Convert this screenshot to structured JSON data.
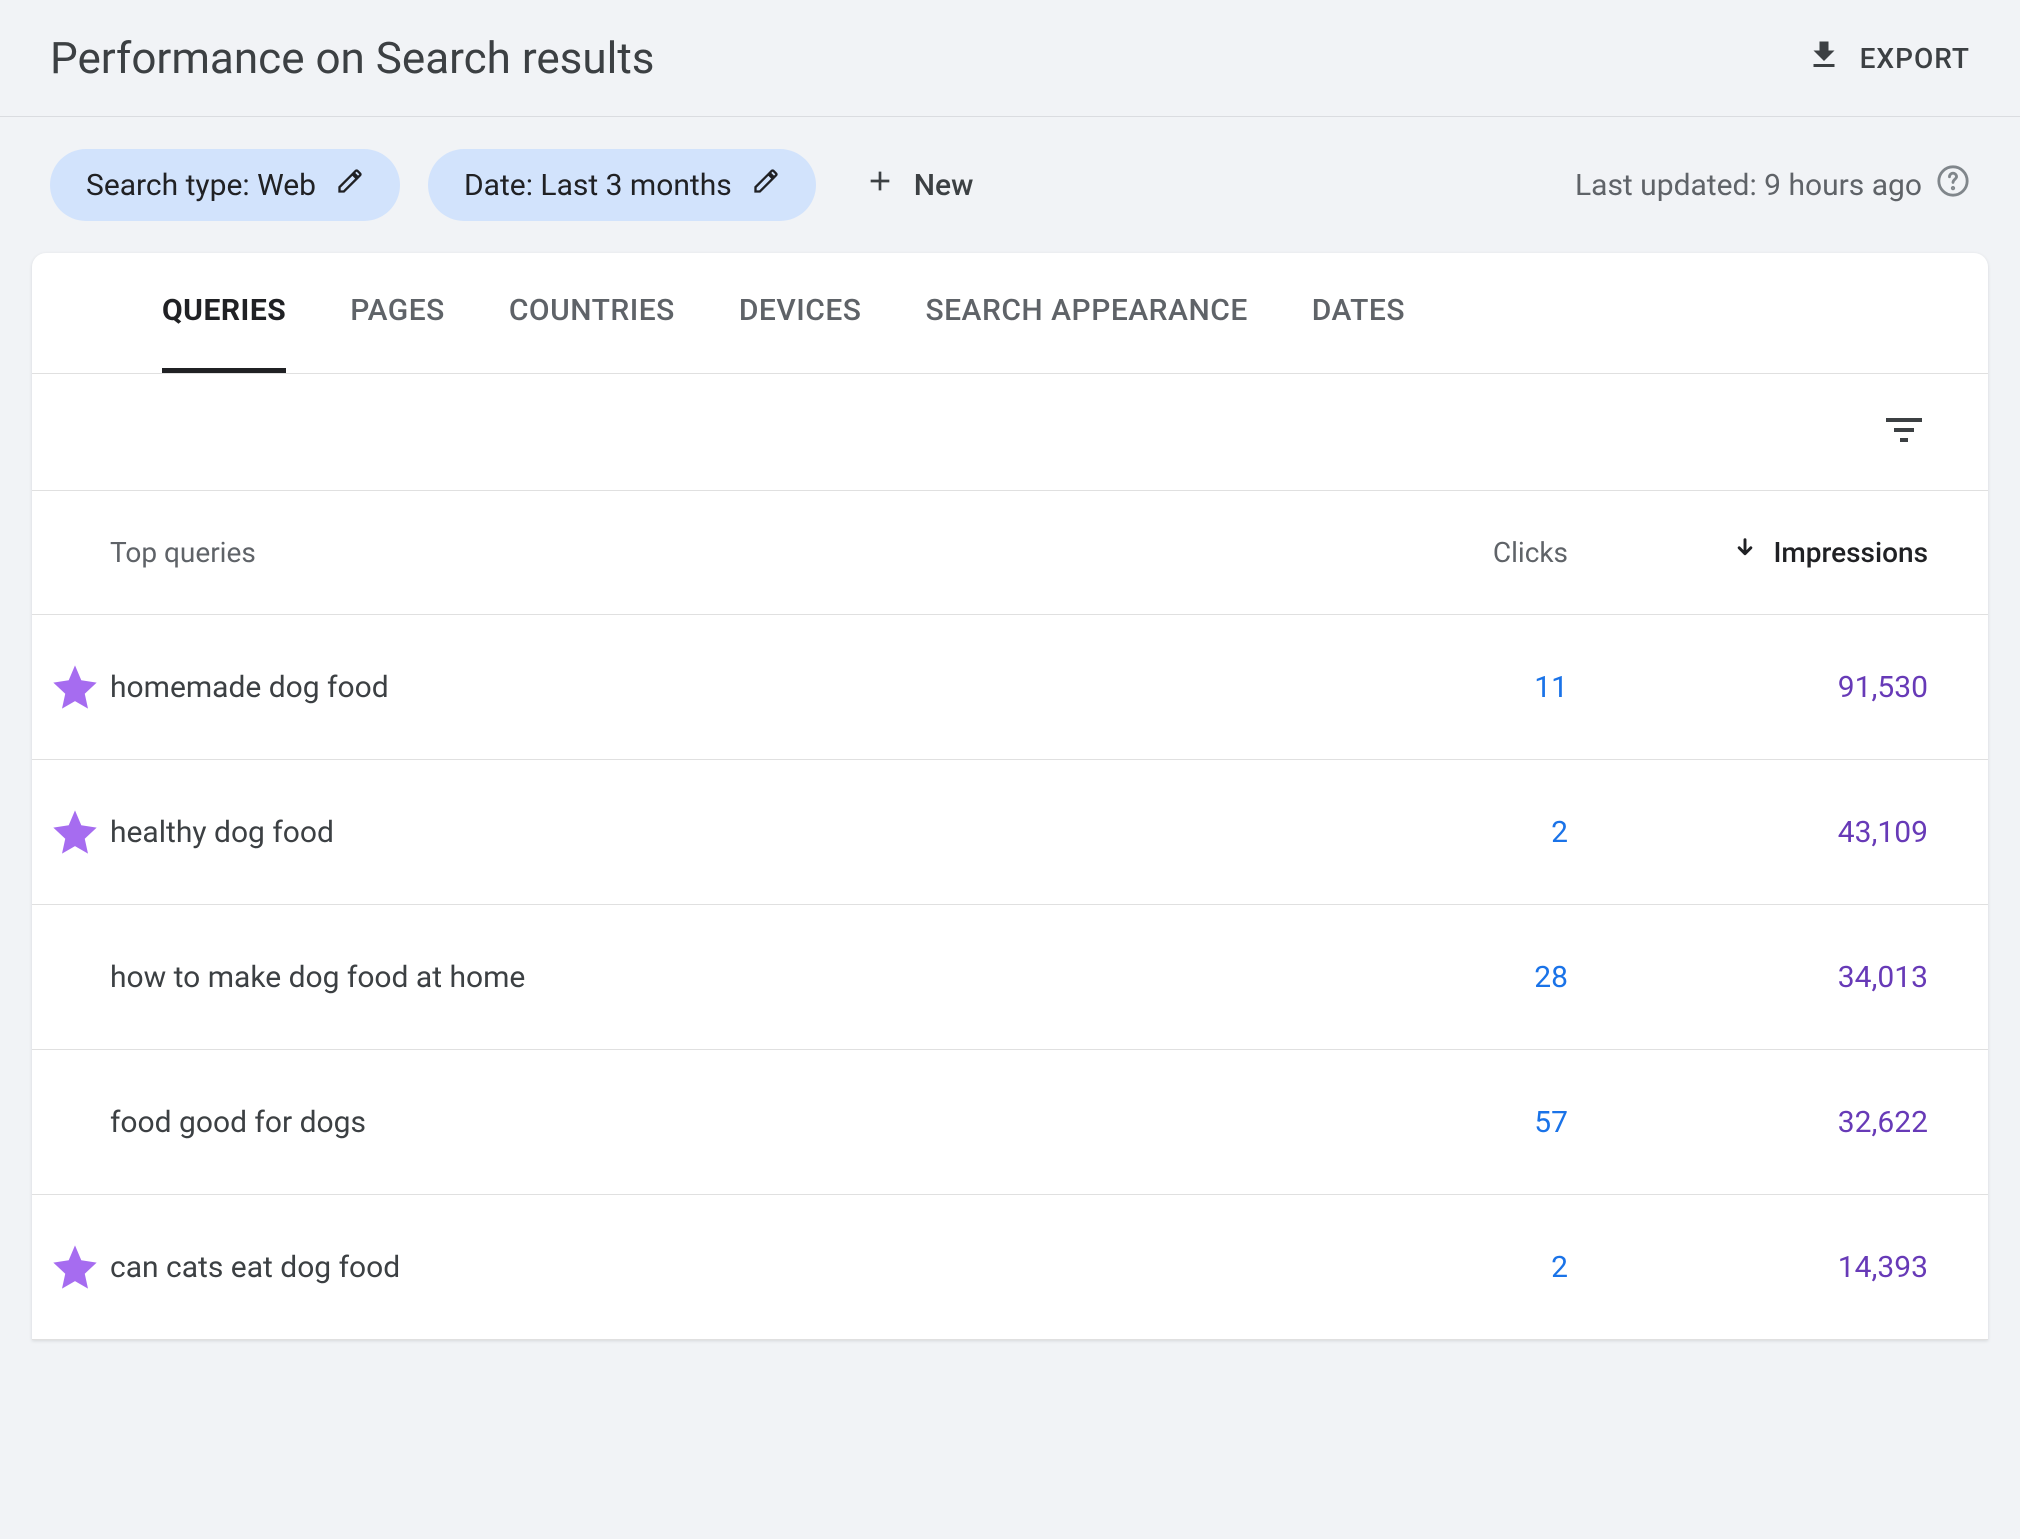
{
  "header": {
    "title": "Performance on Search results",
    "export_label": "EXPORT"
  },
  "filters": {
    "search_type": {
      "label": "Search type: Web"
    },
    "date": {
      "label": "Date: Last 3 months"
    },
    "new_label": "New",
    "last_updated": "Last updated: 9 hours ago"
  },
  "tabs": {
    "queries": "QUERIES",
    "pages": "PAGES",
    "countries": "COUNTRIES",
    "devices": "DEVICES",
    "search_appearance": "SEARCH APPEARANCE",
    "dates": "DATES",
    "active": "queries"
  },
  "table": {
    "header_queries": "Top queries",
    "header_clicks": "Clicks",
    "header_impressions": "Impressions",
    "rows": [
      {
        "starred": true,
        "query": "homemade dog food",
        "clicks": "11",
        "impressions": "91,530"
      },
      {
        "starred": true,
        "query": "healthy dog food",
        "clicks": "2",
        "impressions": "43,109"
      },
      {
        "starred": false,
        "query": "how to make dog food at home",
        "clicks": "28",
        "impressions": "34,013"
      },
      {
        "starred": false,
        "query": "food good for dogs",
        "clicks": "57",
        "impressions": "32,622"
      },
      {
        "starred": true,
        "query": "can cats eat dog food",
        "clicks": "2",
        "impressions": "14,393"
      }
    ]
  },
  "colors": {
    "chip_bg": "#d2e3fc",
    "clicks_color": "#1a73e8",
    "impressions_color": "#673ab7",
    "star_color": "#a66cf0"
  }
}
